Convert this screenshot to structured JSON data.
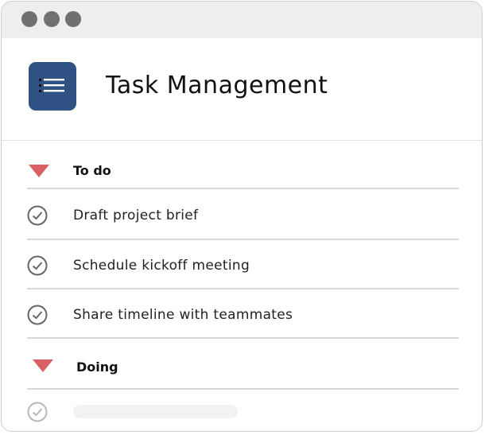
{
  "window": {
    "controls": [
      "close-dot",
      "minimize-dot",
      "maximize-dot"
    ]
  },
  "header": {
    "title": "Task Management",
    "icon": "list-icon",
    "icon_color": "#2f5184"
  },
  "sections": [
    {
      "label": "To do",
      "icon": "triangle-down-icon",
      "tasks": [
        {
          "label": "Draft project brief",
          "icon": "check-circle-icon"
        },
        {
          "label": "Schedule kickoff meeting",
          "icon": "check-circle-icon"
        },
        {
          "label": "Share timeline with teammates",
          "icon": "check-circle-icon"
        }
      ]
    },
    {
      "label": "Doing",
      "icon": "triangle-down-icon",
      "tasks": [
        {
          "label": "",
          "icon": "check-circle-icon"
        }
      ]
    }
  ],
  "colors": {
    "accent_triangle": "#d96164",
    "divider": "#d7d7d7"
  }
}
